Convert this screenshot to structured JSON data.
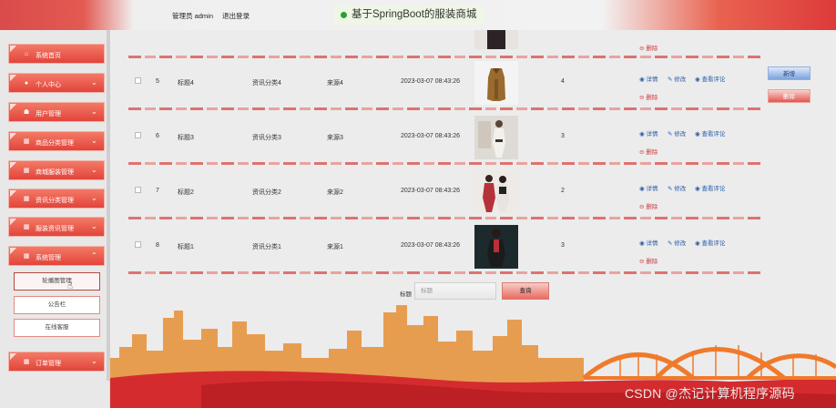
{
  "header": {
    "user_label": "管理员 admin",
    "logout_label": "退出登录",
    "app_title": "基于SpringBoot的服装商城"
  },
  "sidebar": {
    "items": [
      {
        "label": "系统首页",
        "icon": "home-icon"
      },
      {
        "label": "个人中心",
        "icon": "user-icon"
      },
      {
        "label": "用户管理",
        "icon": "users-icon"
      },
      {
        "label": "商品分类管理",
        "icon": "grid-icon"
      },
      {
        "label": "商城服装管理",
        "icon": "grid-icon"
      },
      {
        "label": "资讯分类管理",
        "icon": "grid-icon"
      },
      {
        "label": "服装资讯管理",
        "icon": "grid-icon"
      },
      {
        "label": "系统管理",
        "icon": "grid-icon"
      },
      {
        "label": "订单管理",
        "icon": "grid-icon"
      }
    ],
    "sub_items": [
      {
        "label": "轮播图管理",
        "active": true
      },
      {
        "label": "公告栏",
        "active": false
      },
      {
        "label": "在线客服",
        "active": false
      }
    ]
  },
  "table": {
    "partial_row": {
      "delete_label": "删除"
    },
    "rows": [
      {
        "index": "5",
        "title": "标题4",
        "category": "资讯分类4",
        "source": "来源4",
        "time": "2023-03-07 08:43:26",
        "count": "4"
      },
      {
        "index": "6",
        "title": "标题3",
        "category": "资讯分类3",
        "source": "来源3",
        "time": "2023-03-07 08:43:26",
        "count": "3"
      },
      {
        "index": "7",
        "title": "标题2",
        "category": "资讯分类2",
        "source": "来源2",
        "time": "2023-03-07 08:43:26",
        "count": "2"
      },
      {
        "index": "8",
        "title": "标题1",
        "category": "资讯分类1",
        "source": "来源1",
        "time": "2023-03-07 08:43:26",
        "count": "3"
      }
    ],
    "actions": {
      "detail": "详情",
      "edit": "修改",
      "comments": "查看评论",
      "delete": "删除"
    }
  },
  "toolbar": {
    "new_label": "新增",
    "delete_label": "删除"
  },
  "search": {
    "label": "标题",
    "placeholder": "标题",
    "button_label": "查询"
  },
  "watermark": "CSDN @杰记计算机程序源码",
  "colors": {
    "accent": "#e2443b",
    "link": "#2a5da8",
    "danger": "#d23a3a"
  }
}
